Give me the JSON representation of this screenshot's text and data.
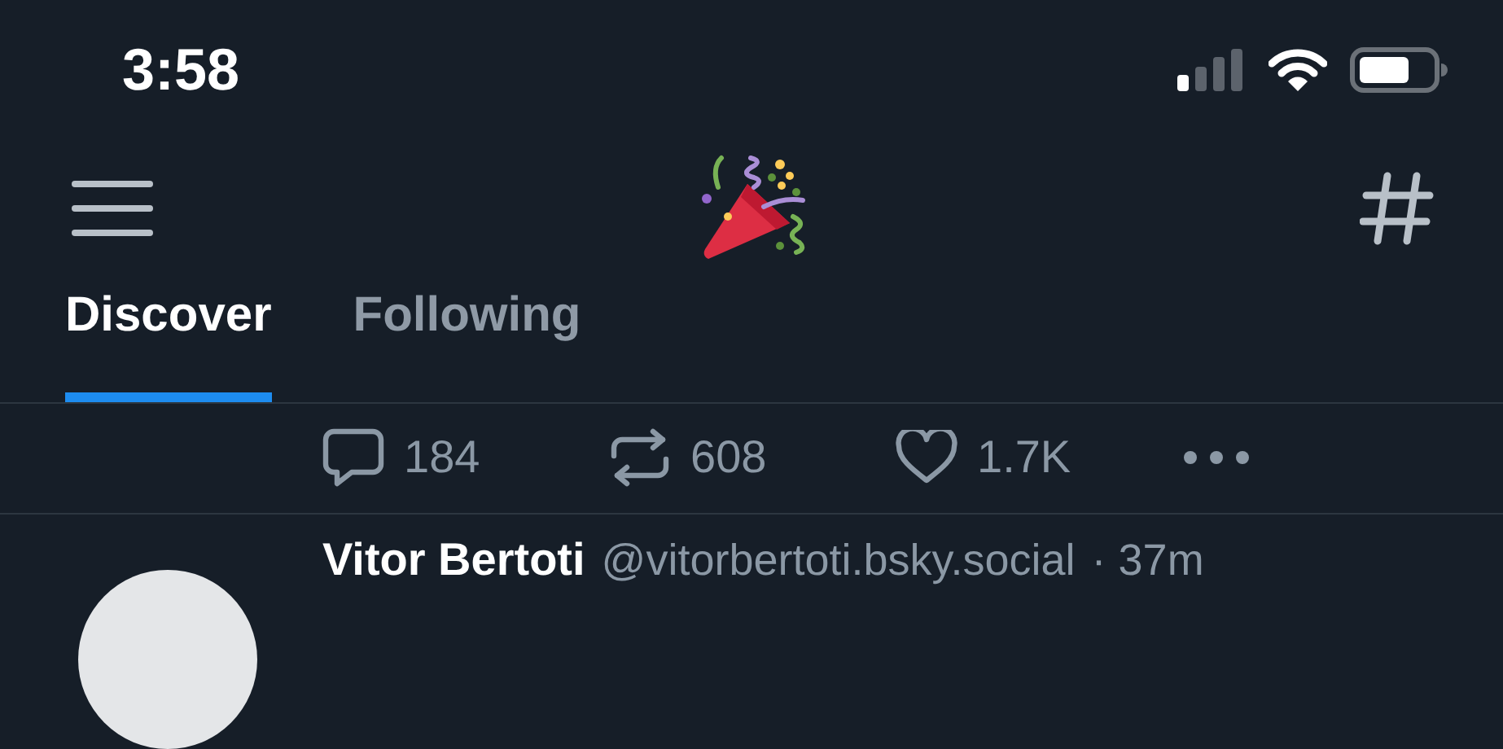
{
  "status_bar": {
    "time": "3:58"
  },
  "tabs": [
    {
      "label": "Discover",
      "selected": true
    },
    {
      "label": "Following",
      "selected": false
    }
  ],
  "actions": [
    {
      "kind": "reply",
      "count": "184"
    },
    {
      "kind": "repost",
      "count": "608"
    },
    {
      "kind": "like",
      "count": "1.7K"
    },
    {
      "kind": "more"
    }
  ],
  "post": {
    "author": "Vitor Bertoti",
    "handle": "@vitorbertoti.bsky.social",
    "time": "· 37m"
  }
}
